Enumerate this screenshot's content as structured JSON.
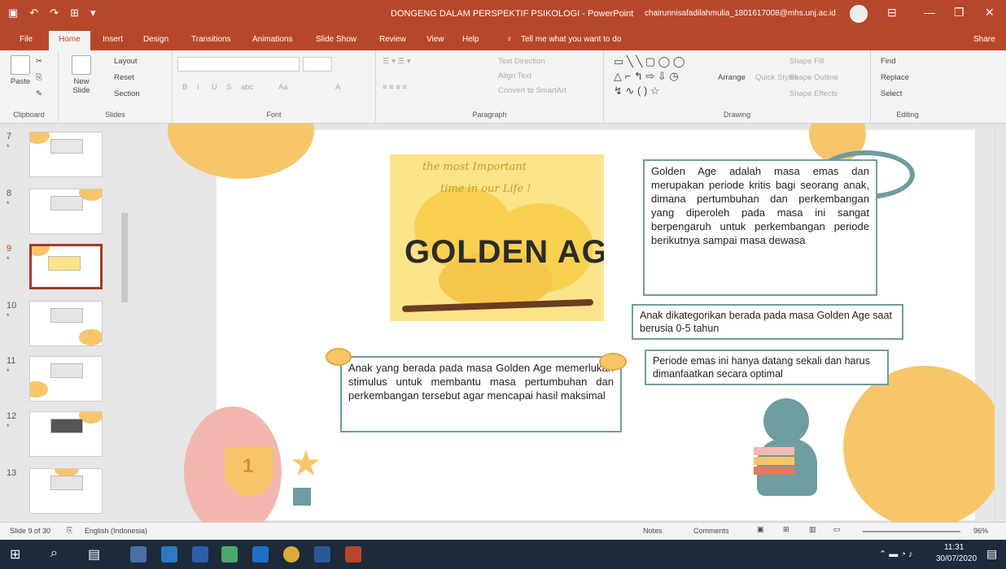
{
  "window": {
    "title": "DONGENG DALAM PERSPEKTIF PSIKOLOGI  -  PowerPoint",
    "user": "chairunnisafadilahmulia_1801617008@mhs.unj.ac.id"
  },
  "tabs": [
    "File",
    "Home",
    "Insert",
    "Design",
    "Transitions",
    "Animations",
    "Slide Show",
    "Review",
    "View",
    "Help"
  ],
  "tell_me": "Tell me what you want to do",
  "share": "Share",
  "ribbon": {
    "clipboard": {
      "paste": "Paste",
      "label": "Clipboard"
    },
    "slides": {
      "new_slide": "New Slide",
      "layout": "Layout",
      "reset": "Reset",
      "section": "Section",
      "label": "Slides"
    },
    "font": {
      "label": "Font",
      "b": "B",
      "i": "I",
      "u": "U",
      "s": "S",
      "abc": "abc",
      "aa": "Aa",
      "a": "A"
    },
    "paragraph": {
      "text_direction": "Text Direction",
      "align_text": "Align Text",
      "smartart": "Convert to SmartArt",
      "label": "Paragraph"
    },
    "drawing": {
      "arrange": "Arrange",
      "quick_styles": "Quick Styles",
      "shape_fill": "Shape Fill",
      "shape_outline": "Shape Outline",
      "shape_effects": "Shape Effects",
      "label": "Drawing"
    },
    "editing": {
      "find": "Find",
      "replace": "Replace",
      "select": "Select",
      "label": "Editing"
    }
  },
  "thumbnails": [
    {
      "num": "7"
    },
    {
      "num": "8"
    },
    {
      "num": "9",
      "selected": true
    },
    {
      "num": "10"
    },
    {
      "num": "11"
    },
    {
      "num": "12"
    },
    {
      "num": "13"
    }
  ],
  "slide": {
    "title_image_text": "GOLDEN AGE",
    "script_line1": "the most Important",
    "script_line2": "time in our Life !",
    "box_main": "Golden Age adalah masa emas dan merupakan periode kritis bagi seorang anak, dimana pertumbuhan dan perkembangan yang diperoleh pada masa ini sangat berpengaruh untuk perkembangan periode berikutnya sampai masa dewasa",
    "box_age": "Anak dikategorikan berada pada masa Golden Age saat berusia 0-5 tahun",
    "box_once": "Periode emas ini hanya datang sekali dan harus dimanfaatkan secara optimal",
    "box_stimulus": "Anak yang berada pada masa Golden Age memerlukan stimulus untuk membantu masa pertumbuhan dan perkembangan tersebut agar mencapai hasil maksimal",
    "trophy_number": "1"
  },
  "status": {
    "slide_of": "Slide 9 of 30",
    "language": "English (Indonesia)",
    "notes": "Notes",
    "comments": "Comments",
    "zoom": "96%"
  },
  "taskbar": {
    "time": "11:31",
    "date": "30/07/2020"
  },
  "colors": {
    "accent": "#b7472a",
    "teal_border": "#6f9ca0",
    "yellow": "#f7c66b",
    "pink": "#f2b8b0"
  }
}
